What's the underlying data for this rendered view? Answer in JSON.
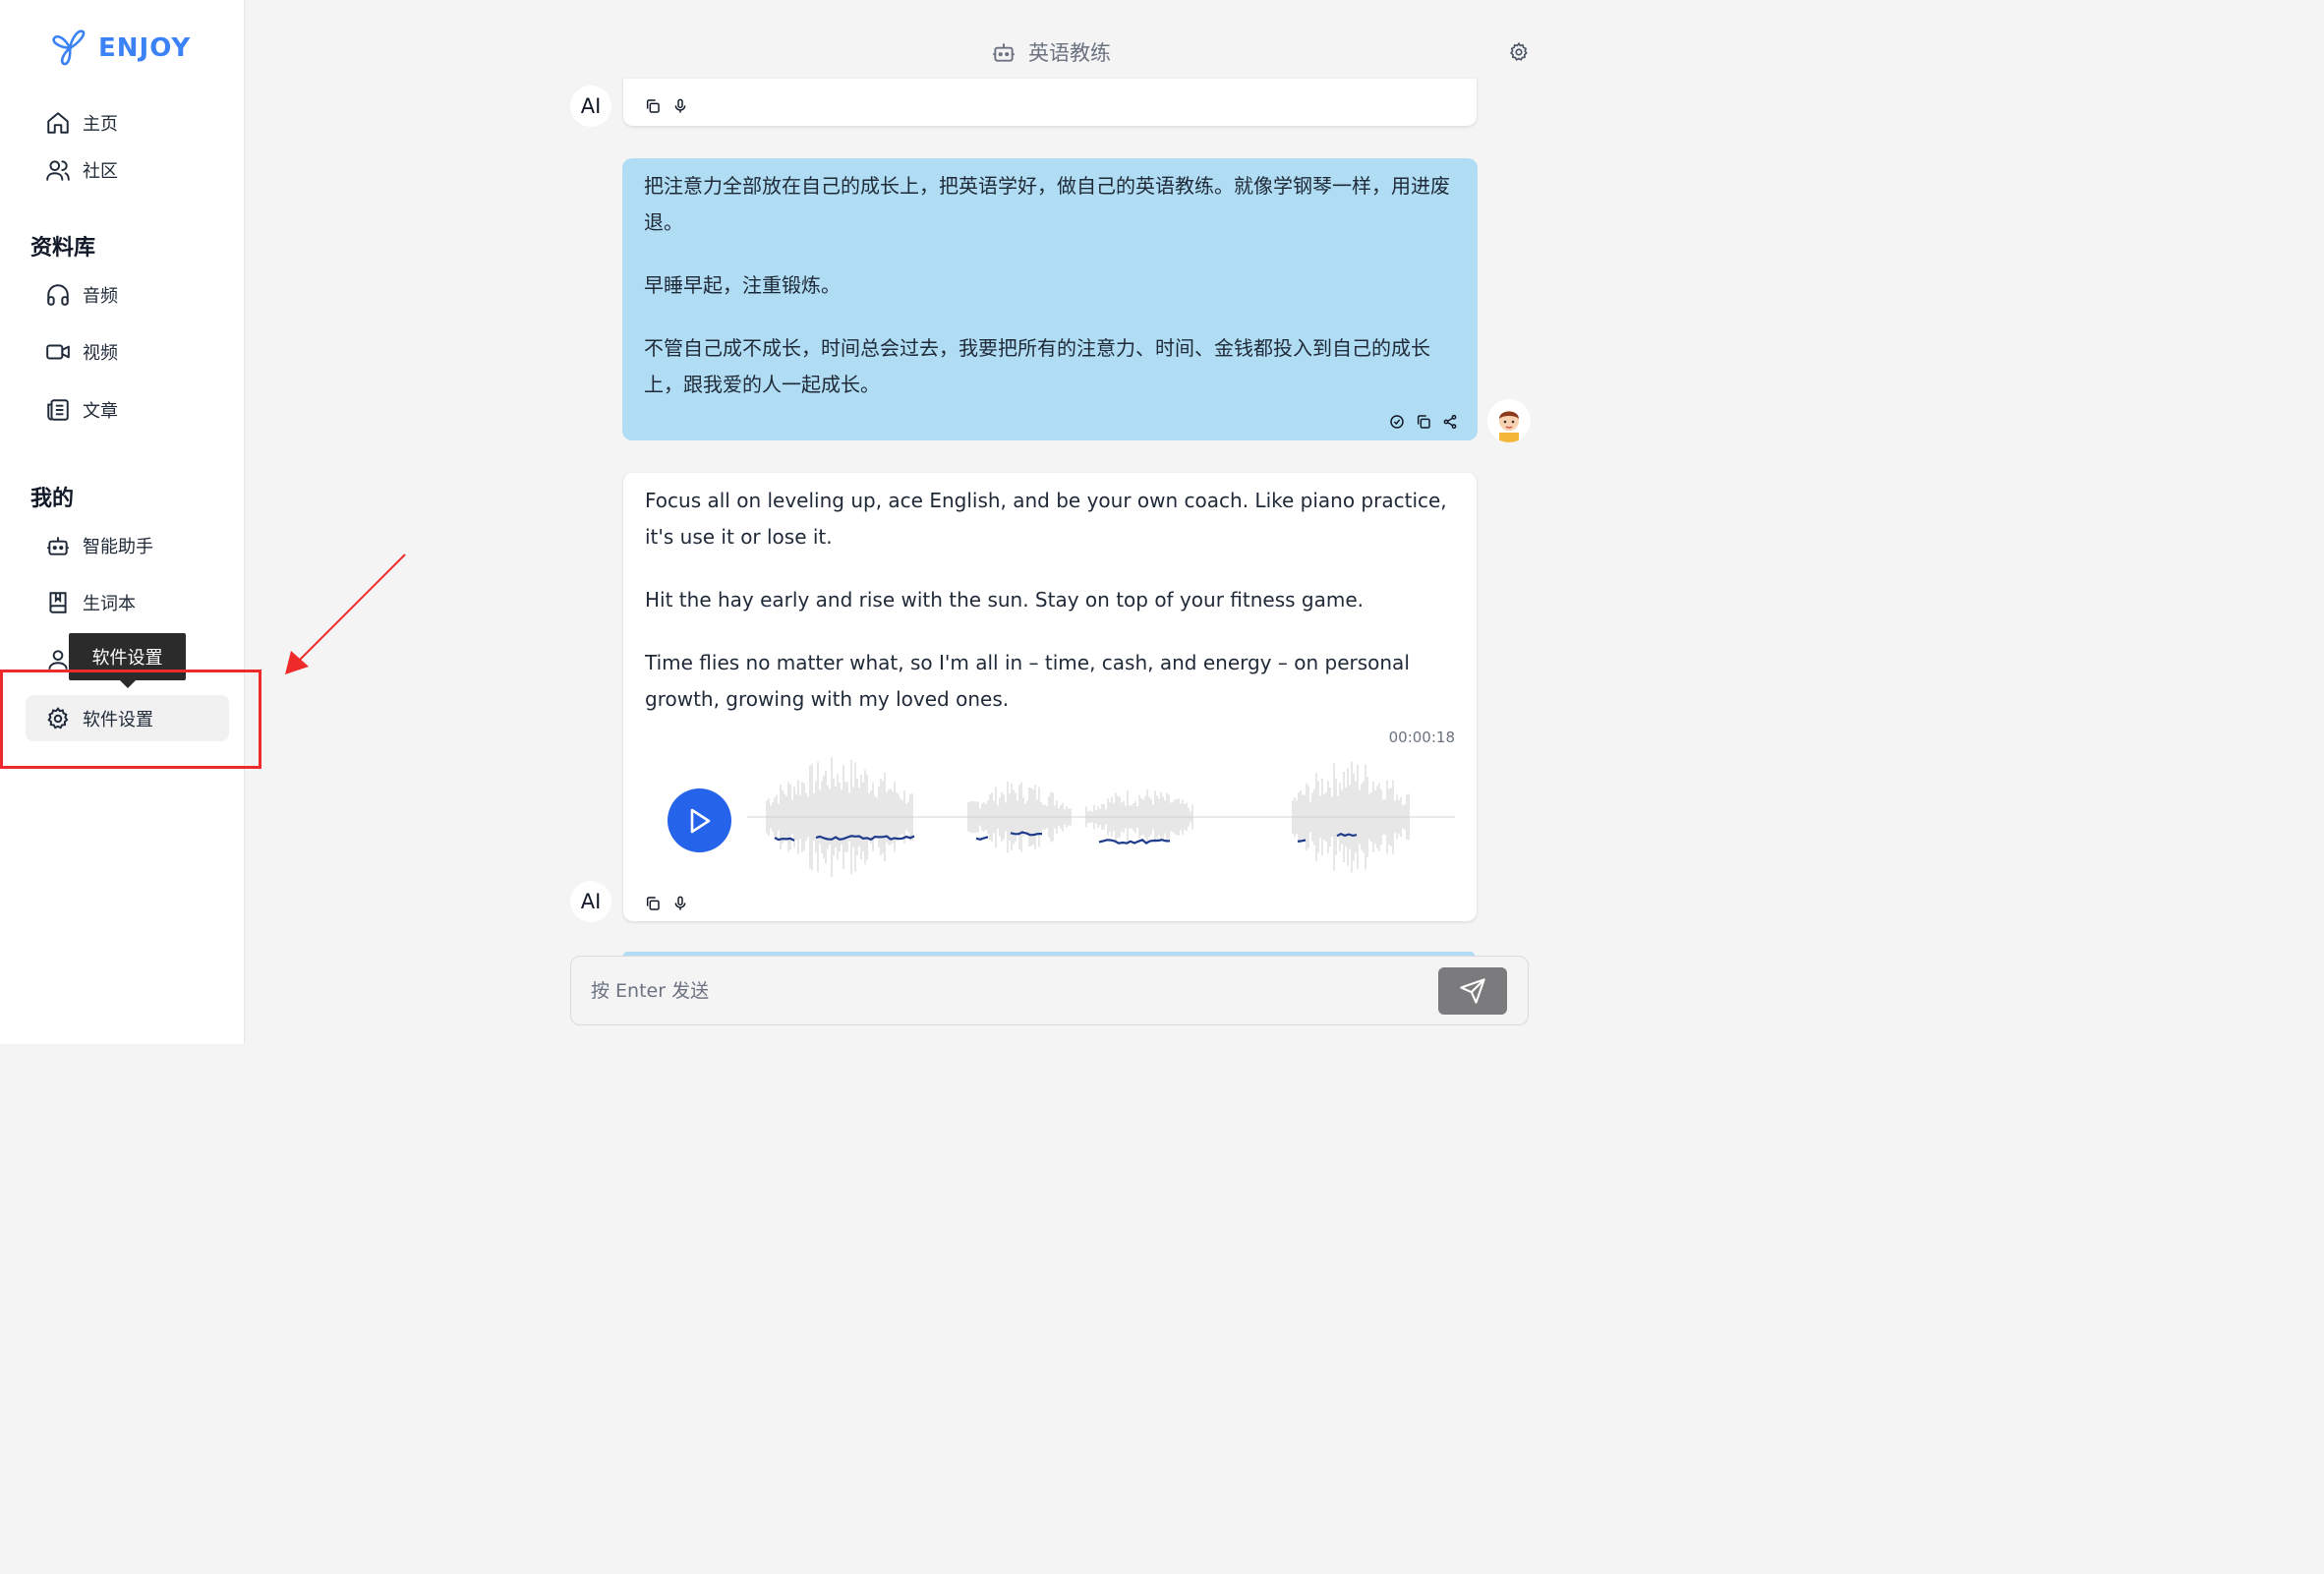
{
  "app": {
    "logo_text": "ENJOY",
    "brand_color": "#3b82f6"
  },
  "sidebar": {
    "nav": [
      {
        "label": "主页",
        "icon": "home-icon"
      },
      {
        "label": "社区",
        "icon": "users-icon"
      }
    ],
    "library_title": "资料库",
    "library": [
      {
        "label": "音频",
        "icon": "headphones-icon"
      },
      {
        "label": "视频",
        "icon": "video-icon"
      },
      {
        "label": "文章",
        "icon": "newspaper-icon"
      }
    ],
    "mine_title": "我的",
    "mine": [
      {
        "label": "智能助手",
        "icon": "bot-icon"
      },
      {
        "label": "生词本",
        "icon": "book-icon"
      },
      {
        "label": "软件设置",
        "icon": "gear-icon",
        "active": true
      }
    ],
    "tooltip": "软件设置"
  },
  "header": {
    "title": "英语教练",
    "icon": "bot-icon"
  },
  "chat": {
    "ai_label": "AI",
    "user_message": {
      "paragraphs": [
        "把注意力全部放在自己的成长上，把英语学好，做自己的英语教练。就像学钢琴一样，用进废退。",
        "早睡早起，注重锻炼。",
        "不管自己成不成长，时间总会过去，我要把所有的注意力、时间、金钱都投入到自己的成长上，跟我爱的人一起成长。"
      ]
    },
    "ai_message": {
      "paragraphs": [
        "Focus all on leveling up, ace English, and be your own coach. Like piano practice, it's use it or lose it.",
        "Hit the hay early and rise with the sun. Stay on top of your fitness game.",
        "Time flies no matter what, so I'm all in – time, cash, and energy – on personal growth, growing with my loved ones."
      ],
      "duration": "00:00:18"
    }
  },
  "input": {
    "placeholder": "按 Enter 发送",
    "value": ""
  },
  "annotation_color": "#ef2a2a",
  "user_bubble_color": "#b0ddf3"
}
